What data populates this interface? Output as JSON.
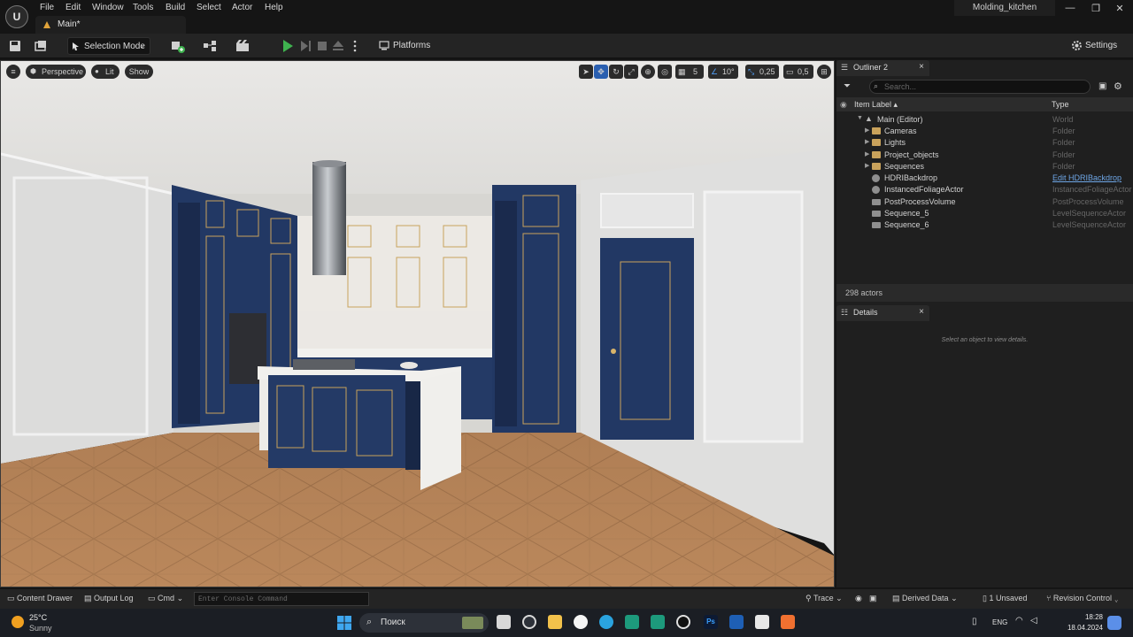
{
  "app": {
    "logo": "unreal-engine-logo",
    "menu": [
      "File",
      "Edit",
      "Window",
      "Tools",
      "Build",
      "Select",
      "Actor",
      "Help"
    ],
    "level_tab": "Main*",
    "project_name": "Molding_kitchen",
    "window_controls": [
      "—",
      "❐",
      "✕"
    ]
  },
  "toolbar": {
    "selection_mode": "Selection Mode",
    "platforms": "Platforms",
    "settings": "Settings",
    "icons": [
      "save-icon",
      "content-browser-icon",
      "add-actor-icon",
      "blueprint-icon",
      "cinematics-icon",
      "play-icon",
      "step-icon",
      "stop-icon",
      "eject-icon",
      "more-options-icon"
    ],
    "play_color": "#3fb34f"
  },
  "viewport": {
    "view_mode": "Perspective",
    "lighting": "Lit",
    "show": "Show",
    "grid_snap": "5",
    "rotation_snap": "10°",
    "scale_snap": "0,25",
    "camera_speed": "0,5"
  },
  "outliner": {
    "tab_title": "Outliner 2",
    "search_placeholder": "Search...",
    "col_label": "Item Label ▴",
    "col_type": "Type",
    "rows": [
      {
        "label": "Main (Editor)",
        "type": "World"
      },
      {
        "label": "Cameras",
        "type": "Folder"
      },
      {
        "label": "Lights",
        "type": "Folder"
      },
      {
        "label": "Project_objects",
        "type": "Folder"
      },
      {
        "label": "Sequences",
        "type": "Folder"
      },
      {
        "label": "HDRIBackdrop",
        "type": "Edit HDRIBackdrop"
      },
      {
        "label": "InstancedFoliageActor",
        "type": "InstancedFoliageActor"
      },
      {
        "label": "PostProcessVolume",
        "type": "PostProcessVolume"
      },
      {
        "label": "Sequence_5",
        "type": "LevelSequenceActor"
      },
      {
        "label": "Sequence_6",
        "type": "LevelSequenceActor"
      }
    ],
    "actor_count": "298 actors"
  },
  "details": {
    "tab_title": "Details",
    "empty_message": "Select an object to view details."
  },
  "statusbar": {
    "content_drawer": "Content Drawer",
    "output_log": "Output Log",
    "cmd": "Cmd",
    "console_placeholder": "Enter Console Command",
    "trace": "Trace",
    "derived_data": "Derived Data",
    "unsaved": "1 Unsaved",
    "revision_control": "Revision Control"
  },
  "taskbar": {
    "temperature": "25°C",
    "weather": "Sunny",
    "search_label": "Поиск",
    "language": "ENG",
    "time": "18:28",
    "date": "18.04.2024"
  }
}
